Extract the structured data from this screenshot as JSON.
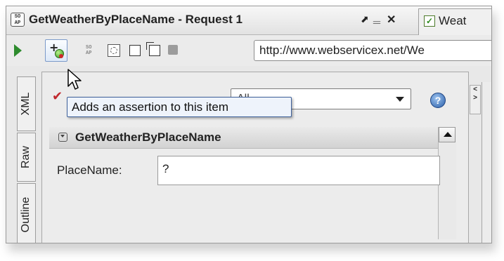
{
  "window": {
    "title": "GetWeatherByPlaceName - Request 1",
    "soap_icon_text": "SO\nAP",
    "controls": {
      "pin": "⬈",
      "minimize": "‗",
      "close": "✕"
    },
    "second_tab": {
      "label": "Weat"
    }
  },
  "toolbar": {
    "url": "http://www.webservicex.net/We"
  },
  "vertical_tabs": [
    "XML",
    "Raw",
    "Outline"
  ],
  "assertions": {
    "combo_value": "All"
  },
  "tooltip": {
    "text": "Adds an assertion to this item"
  },
  "operation": {
    "title": "GetWeatherByPlaceName"
  },
  "form": {
    "field_label": "PlaceName:",
    "field_value": "?"
  },
  "colors": {
    "run_green": "#2e8b2e",
    "tooltip_bg": "#eef3fb",
    "assertion_red": "#c0282d"
  }
}
